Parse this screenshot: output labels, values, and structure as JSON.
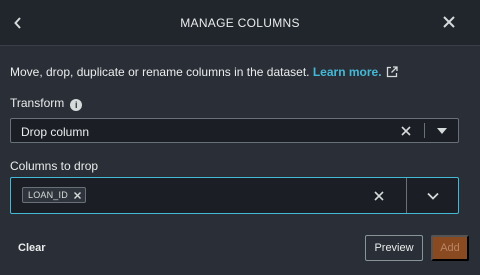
{
  "header": {
    "title": "MANAGE COLUMNS",
    "back_icon": "chevron-left-icon",
    "close_icon": "close-icon"
  },
  "description": {
    "text": "Move, drop, duplicate or rename columns in the dataset. ",
    "link_label": "Learn more."
  },
  "transform": {
    "label": "Transform",
    "selected": "Drop column"
  },
  "columns_to_drop": {
    "label": "Columns to drop",
    "tokens": [
      "LOAN_ID"
    ]
  },
  "footer": {
    "clear_label": "Clear",
    "preview_label": "Preview",
    "add_label": "Add"
  },
  "colors": {
    "background": "#2a2e36",
    "header": "#21252c",
    "link": "#44b9d6",
    "focus_border": "#44b9d6",
    "add_button": "#8a4a21"
  }
}
